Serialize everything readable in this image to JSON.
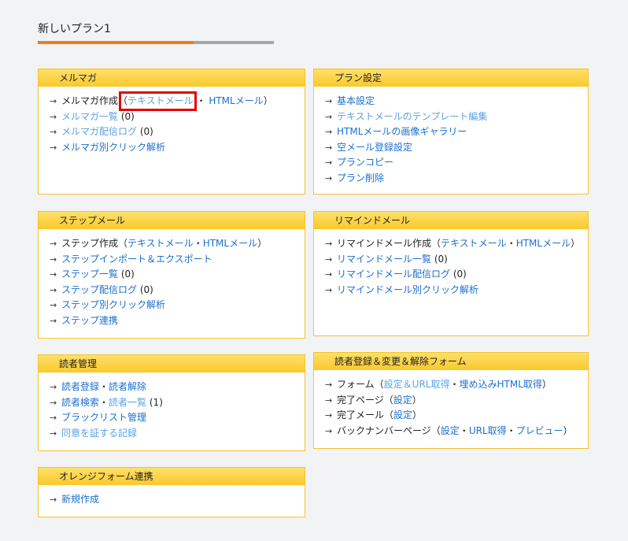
{
  "page": {
    "title": "新しいプラン1",
    "progress": 0.66
  },
  "panels": {
    "mailmag": {
      "title": "メルマガ",
      "create_label": "メルマガ作成",
      "text_mail": "テキストメール",
      "html_mail": "HTMLメール",
      "list": "メルマガ一覧",
      "list_count": "(0)",
      "log": "メルマガ配信ログ",
      "log_count": "(0)",
      "click": "メルマガ別クリック解析"
    },
    "plan": {
      "title": "プラン設定",
      "items": [
        "基本設定",
        "テキストメールのテンプレート編集",
        "HTMLメールの画像ギャラリー",
        "空メール登録設定",
        "プランコピー",
        "プラン削除"
      ]
    },
    "step": {
      "title": "ステップメール",
      "create_label": "ステップ作成",
      "text_mail": "テキストメール",
      "html_mail": "HTMLメール",
      "import": "ステップインポート＆エクスポート",
      "list": "ステップ一覧",
      "list_count": "(0)",
      "log": "ステップ配信ログ",
      "log_count": "(0)",
      "click": "ステップ別クリック解析",
      "link": "ステップ連携"
    },
    "remind": {
      "title": "リマインドメール",
      "create_label": "リマインドメール作成",
      "text_mail": "テキストメール",
      "html_mail": "HTMLメール",
      "list": "リマインドメール一覧",
      "list_count": "(0)",
      "log": "リマインドメール配信ログ",
      "log_count": "(0)",
      "click": "リマインドメール別クリック解析"
    },
    "reader": {
      "title": "読者管理",
      "register": "読者登録",
      "unregister": "読者解除",
      "search": "読者検索",
      "list": "読者一覧",
      "list_count": "(1)",
      "blacklist": "ブラックリスト管理",
      "consent": "同意を証する記録"
    },
    "forms": {
      "title": "読者登録＆変更＆解除フォーム",
      "form_label": "フォーム",
      "form_settings": "設定＆URL取得",
      "form_embed": "埋め込みHTML取得",
      "done_page": "完了ページ",
      "done_mail": "完了メール",
      "settings": "設定",
      "backnumber": "バックナンバーページ",
      "url_get": "URL取得",
      "preview": "プレビュー"
    },
    "orange": {
      "title": "オレンジフォーム連携",
      "new": "新規作成"
    }
  },
  "colors": {
    "accent": "#f07d1a",
    "link": "#1a6fd0",
    "panel_border": "#f2c430",
    "highlight": "#e60000"
  }
}
